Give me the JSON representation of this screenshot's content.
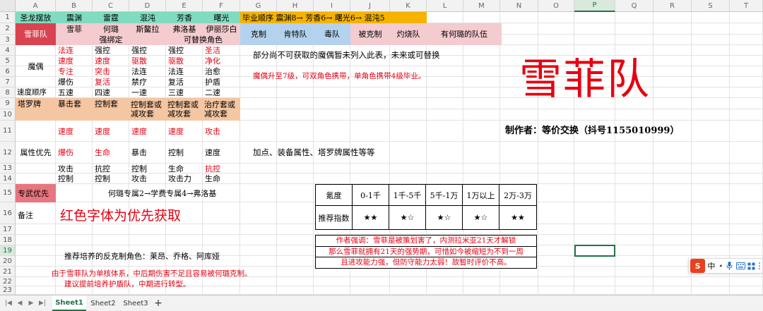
{
  "sheet": {
    "columns": [
      "A",
      "B",
      "C",
      "D",
      "E",
      "F",
      "G",
      "H",
      "I",
      "J",
      "K",
      "L",
      "M",
      "N",
      "O",
      "P",
      "Q",
      "R",
      "S",
      "T"
    ],
    "rows": [
      "1",
      "2",
      "3",
      "4",
      "5",
      "6",
      "7",
      "8",
      "9",
      "10",
      "11",
      "12",
      "13",
      "14",
      "15",
      "16",
      "17",
      "18",
      "19",
      "20",
      "21",
      "22",
      "23"
    ],
    "selected_column": "P",
    "selected_row": "19"
  },
  "cells": {
    "r1": [
      "圣龙摆放",
      "震渊",
      "雷霆",
      "混沌",
      "芳香",
      "曙光"
    ],
    "r1_note": "毕业顺序 震渊8→ 芳香6→ 曙光6→ 混沌5",
    "team_label": "雪菲队",
    "r2": [
      "雪菲",
      "何璐",
      "斯鳌拉",
      "弗洛基",
      "伊丽莎白"
    ],
    "r3": [
      "强绑定",
      "可替换角色"
    ],
    "r2_tags": [
      "克制",
      "肯特队",
      "毒队",
      "被克制",
      "灼烧队",
      "有何璐的队伍"
    ],
    "puppet_label": "魔偶",
    "puppets": [
      [
        "法连",
        "强控",
        "强控",
        "强控",
        "圣洁"
      ],
      [
        "速度",
        "速度",
        "驱散",
        "驱散",
        "净化"
      ],
      [
        "专注",
        "突击",
        "法连",
        "法连",
        "治愈"
      ],
      [
        "爆伤",
        "复活",
        "禁疗",
        "复活",
        "护盾"
      ]
    ],
    "speed_label": "速度顺序",
    "speed": [
      "五速",
      "四速",
      "一速",
      "三速",
      "二速"
    ],
    "tarot_label": "塔罗牌",
    "tarot": [
      "暴击套",
      "控制套",
      "控制套或减攻套",
      "控制套或减攻套",
      "治疗套或减攻套"
    ],
    "attr_label": "属性优先",
    "attrs": [
      [
        "速度",
        "速度",
        "速度",
        "速度",
        "攻击"
      ],
      [
        "爆伤",
        "生命",
        "暴击",
        "控制",
        "速度"
      ],
      [
        "攻击",
        "抗控",
        "控制",
        "生命",
        "抗控"
      ],
      [
        "控制",
        "控制",
        "攻击",
        "攻击力",
        "生命"
      ]
    ],
    "note_puppet": "部分尚不可获取的魔偶暂未列入此表，未来或可替换",
    "note_puppet_level": "魔偶升至7级，可双角色携带，单角色携带4级毕业。",
    "note_attr": "加点、装备属性、塔罗牌属性等等",
    "big_title": "雪菲队",
    "author": "制作者：等价交换（抖号1155010999）",
    "exclusive_label": "专武优先",
    "exclusive": "何璐专属2→学费专属4→弗洛基",
    "remark_label": "备注",
    "remark": "红色字体为优先获取",
    "counter_roles": "推荐培养的反克制角色：莱昂、乔格、阿库娅",
    "advice1": "由于雪菲队为单核体系，中后期伤害不足且容易被何璐克制。",
    "advice2": "建议提前培养护盾队，中期进行转型。",
    "table_header": [
      "氪度",
      "0-1千",
      "1千-5千",
      "5千-1万",
      "1万以上",
      "2万-3万"
    ],
    "table_rec_label": "推荐指数",
    "table_rec": [
      "★★",
      "★☆",
      "★☆",
      "★☆",
      "★★"
    ],
    "author_note1": "作者强调：雪菲是被策划害了，内测拉米亚21天才解锁",
    "author_note2": "那么雪菲就拥有21天的强势期，可惜如今被缩短为不到一周",
    "author_note3": "且进攻能力强，但防守能力太弱！故暂时评价不高。"
  },
  "tabs": [
    "Sheet1",
    "Sheet2",
    "Sheet3"
  ],
  "tab_add": "+",
  "ime": {
    "label": "中",
    "dot": "•"
  },
  "colors": {
    "teal": "#7fdcc0",
    "gold": "#f5b300",
    "pink": "#f4cbcf",
    "blue": "#b4d2ee",
    "orange": "#f5c6a2",
    "red_label": "#d9434f",
    "red_text": "#e60012",
    "selection": "#217346"
  }
}
